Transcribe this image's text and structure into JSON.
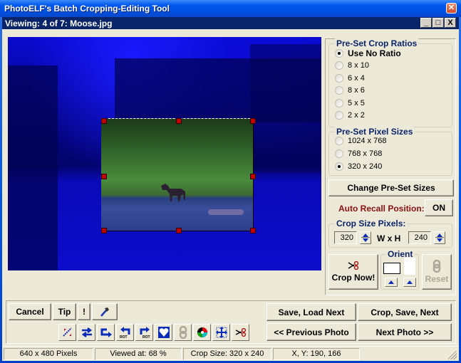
{
  "app": {
    "title": "PhotoELF's Batch Cropping-Editing Tool",
    "close_glyph": "✕"
  },
  "viewer_window": {
    "title": "Viewing:  4 of 7: Moose.jpg",
    "controls": {
      "minimize": "_",
      "maximize": "□",
      "close": "X"
    }
  },
  "crop_ratios": {
    "title": "Pre-Set Crop Ratios",
    "options": [
      {
        "label": "Use No Ratio",
        "selected": true
      },
      {
        "label": "8 x 10",
        "selected": false
      },
      {
        "label": "6 x 4",
        "selected": false
      },
      {
        "label": "8 x 6",
        "selected": false
      },
      {
        "label": "5 x 5",
        "selected": false
      },
      {
        "label": "2 x 2",
        "selected": false
      }
    ]
  },
  "pixel_sizes": {
    "title": "Pre-Set Pixel Sizes",
    "options": [
      {
        "label": "1024 x 768",
        "selected": false
      },
      {
        "label": "768 x 768",
        "selected": false
      },
      {
        "label": "320 x 240",
        "selected": true
      }
    ]
  },
  "change_presets_label": "Change Pre-Set Sizes",
  "auto_recall": {
    "label": "Auto Recall Position:",
    "value": "ON",
    "color": "#8b1010"
  },
  "crop_size": {
    "title": "Crop Size Pixels:",
    "width": "320",
    "height": "240",
    "separator": "W x H"
  },
  "crop_now_label": "Crop Now!",
  "orient": {
    "title": "Orient"
  },
  "reset_label": "Reset",
  "left_buttons": {
    "cancel": "Cancel",
    "tip": "Tip",
    "exclaim": "!"
  },
  "tool_icons": [
    "swap-diagonal-icon",
    "flip-horizontal-icon",
    "redo-arrow-icon",
    "rotate-left-icon",
    "rotate-right-icon",
    "heart-frame-icon",
    "link-icon",
    "color-wheel-icon",
    "move-crop-icon",
    "scissors-icon"
  ],
  "nav_buttons": {
    "save_load_next": "Save, Load Next",
    "crop_save_next": "Crop, Save, Next",
    "previous_photo": "<< Previous Photo",
    "next_photo": "Next Photo >>"
  },
  "status_bar": {
    "dimensions": "640 x 480 Pixels",
    "zoom": "Viewed at: 68 %",
    "crop_size": "Crop Size: 320 x 240",
    "cursor": "X, Y: 190, 166"
  },
  "colors": {
    "group_title": "#0a246a",
    "handle": "#c00000",
    "face": "#ece9d8"
  }
}
